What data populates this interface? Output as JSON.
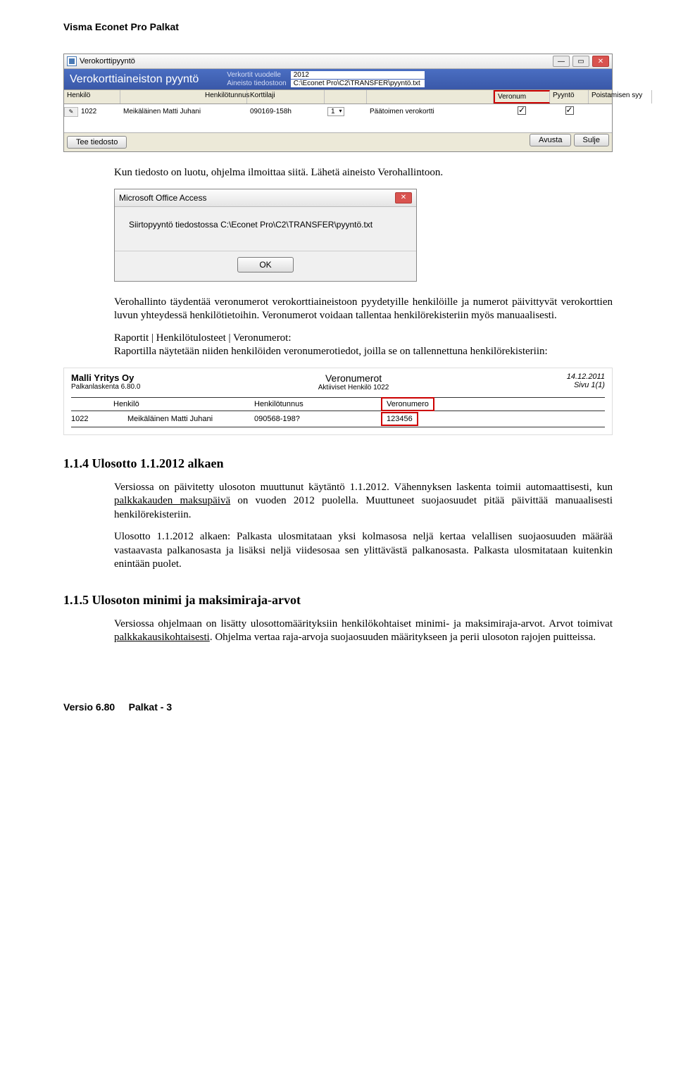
{
  "doc": {
    "header": "Visma Econet Pro Palkat",
    "footer_version": "Versio 6.80",
    "footer_page": "Palkat - 3"
  },
  "win1": {
    "title": "Verokorttipyyntö",
    "banner_title": "Verokorttiaineiston pyyntö",
    "fields": {
      "vuodelle_label": "Verkortit vuodelle",
      "vuodelle_value": "2012",
      "tiedostoon_label": "Aineisto tiedostoon",
      "tiedostoon_value": "C:\\Econet Pro\\C2\\TRANSFER\\pyyntö.txt"
    },
    "cols": {
      "henkilo": "Henkilö",
      "henkilotunnus": "Henkilötunnus",
      "korttilaji": "Korttilaji",
      "veronum": "Veronum",
      "pyynto": "Pyyntö",
      "poistamisen": "Poistamisen syy"
    },
    "row": {
      "num": "1022",
      "name": "Meikäläinen Matti Juhani",
      "hetu": "090169-158h",
      "korttilaji_num": "1",
      "korttilaji_text": "Päätoimen verokortti"
    },
    "buttons": {
      "tee": "Tee tiedosto",
      "avusta": "Avusta",
      "sulje": "Sulje"
    }
  },
  "para1": "Kun tiedosto on luotu, ohjelma ilmoittaa siitä. Lähetä aineisto Verohallintoon.",
  "access": {
    "title": "Microsoft Office Access",
    "msg": "Siirtopyyntö tiedostossa C:\\Econet Pro\\C2\\TRANSFER\\pyyntö.txt",
    "ok": "OK"
  },
  "para2": "Verohallinto täydentää veronumerot verokorttiaineistoon pyydetyille henkilöille ja numerot päivittyvät verokorttien luvun yhteydessä henkilötietoihin. Veronumerot voidaan tallentaa henkilörekisteriin myös manuaalisesti.",
  "para3a": "Raportit | Henkilötulosteet | Veronumerot:",
  "para3b": "Raportilla näytetään niiden henkilöiden veronumerotiedot, joilla se on tallennettuna henkilörekisteriin:",
  "report": {
    "company": "Malli Yritys Oy",
    "version": "Palkanlaskenta 6.80.0",
    "title": "Veronumerot",
    "subtitle": "Aktiiviset Henkilö 1022",
    "date": "14.12.2011",
    "page": "Sivu 1(1)",
    "col_henkilo": "Henkilö",
    "col_hetu": "Henkilötunnus",
    "col_veronum": "Veronumero",
    "row_num": "1022",
    "row_name": "Meikäläinen Matti Juhani",
    "row_hetu": "090568-198?",
    "row_veronum": "123456"
  },
  "sec114": {
    "heading": "1.1.4  Ulosotto 1.1.2012 alkaen",
    "p1a": "Versiossa on päivitetty ulosoton muuttunut käytäntö 1.1.2012. Vähennyksen laskenta toimii automaattisesti, kun ",
    "p1b_underline": "palkkakauden maksupäivä",
    "p1c": " on vuoden 2012 puolella. Muuttuneet suojaosuudet pitää päivittää manuaalisesti henkilörekisteriin.",
    "p2": "Ulosotto 1.1.2012 alkaen: Palkasta ulosmitataan yksi kolmasosa neljä kertaa velallisen suojaosuuden määrää vastaavasta palkanosasta ja lisäksi neljä viidesosaa sen ylittävästä palkanosasta. Palkasta ulosmitataan kuitenkin enintään puolet."
  },
  "sec115": {
    "heading": "1.1.5  Ulosoton minimi ja maksimiraja-arvot",
    "p1a": "Versiossa ohjelmaan on lisätty ulosottomäärityksiin henkilökohtaiset minimi- ja maksimiraja-arvot. Arvot toimivat ",
    "p1b_underline": "palkkakausikohtaisesti",
    "p1c": ". Ohjelma vertaa raja-arvoja suojaosuuden määritykseen ja perii ulosoton rajojen puitteissa."
  }
}
